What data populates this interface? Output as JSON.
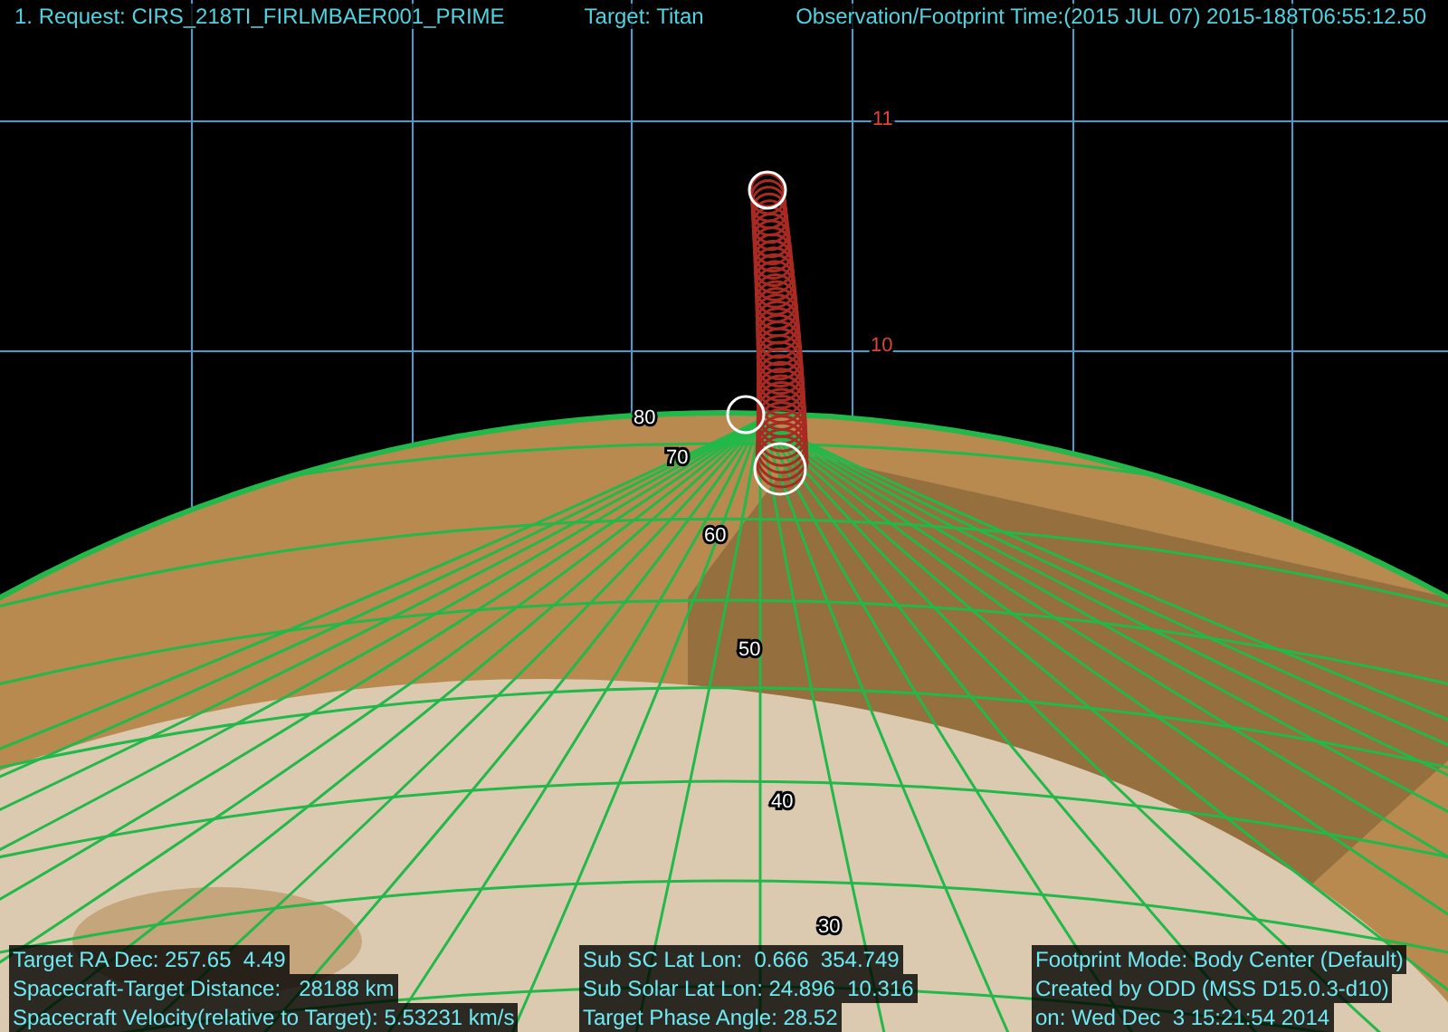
{
  "header": {
    "request": "1. Request: CIRS_218TI_FIRLMBAER001_PRIME",
    "target": "Target: Titan",
    "time": "Observation/Footprint Time:(2015 JUL 07) 2015-188T06:55:12.50"
  },
  "range_labels": [
    "11",
    "10"
  ],
  "latitude_labels": [
    "80",
    "70",
    "60",
    "50",
    "40",
    "30"
  ],
  "info_left": [
    "Target RA Dec: 257.65  4.49",
    "Spacecraft-Target Distance:   28188 km",
    "Spacecraft Velocity(relative to Target): 5.53231 km/s"
  ],
  "info_middle": [
    "Sub SC Lat Lon:  0.666  354.749",
    "Sub Solar Lat Lon: 24.896  10.316",
    "Target Phase Angle: 28.52"
  ],
  "info_right": [
    "Footprint Mode: Body Center (Default)",
    "Created by ODD (MSS D15.0.3-d10)",
    "on: Wed Dec  3 15:21:54 2014"
  ]
}
